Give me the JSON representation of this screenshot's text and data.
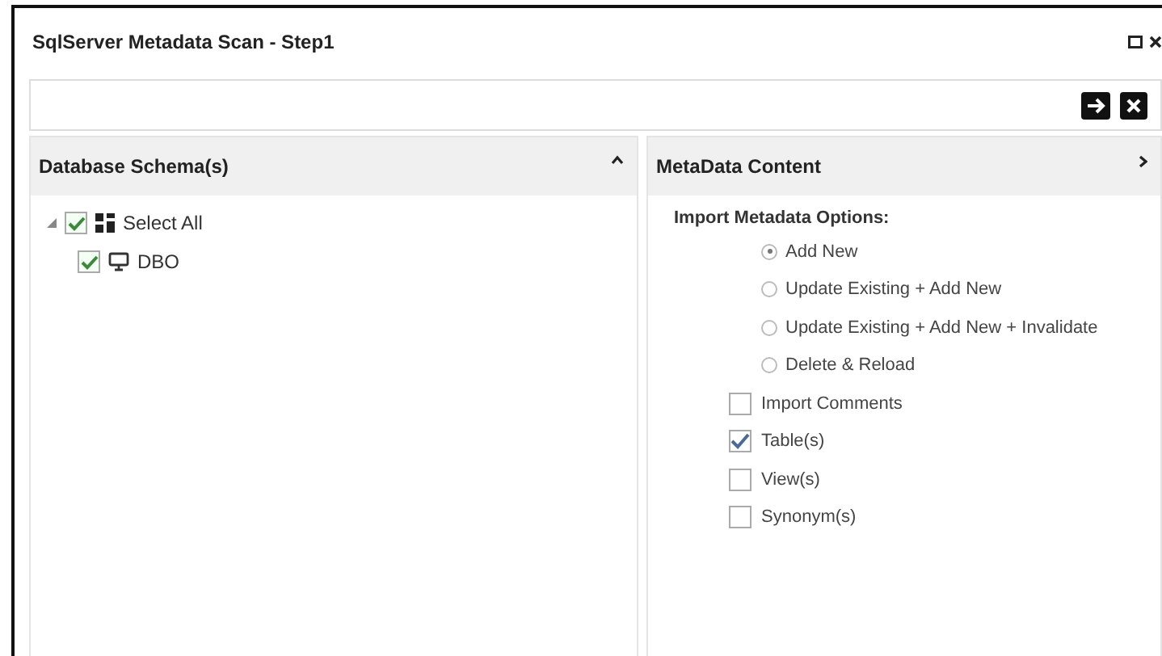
{
  "window": {
    "title": "SqlServer Metadata Scan - Step1"
  },
  "left_panel": {
    "title": "Database Schema(s)",
    "tree": [
      {
        "label": "Select All",
        "expanded": true,
        "checked": true,
        "kind": "group",
        "children": [
          {
            "label": "DBO",
            "checked": true,
            "kind": "schema"
          }
        ]
      }
    ]
  },
  "right_panel": {
    "title": "MetaData Content",
    "section_label": "Import Metadata Options:",
    "options": [
      {
        "label": "Add New",
        "selected": true
      },
      {
        "label": "Update Existing + Add New",
        "selected": false
      },
      {
        "label": "Update Existing + Add New + Invalidate",
        "selected": false
      },
      {
        "label": "Delete & Reload",
        "selected": false
      }
    ],
    "checkboxes": [
      {
        "label": "Import Comments",
        "checked": false
      },
      {
        "label": "Table(s)",
        "checked": true
      },
      {
        "label": "View(s)",
        "checked": false
      },
      {
        "label": "Synonym(s)",
        "checked": false
      }
    ]
  }
}
